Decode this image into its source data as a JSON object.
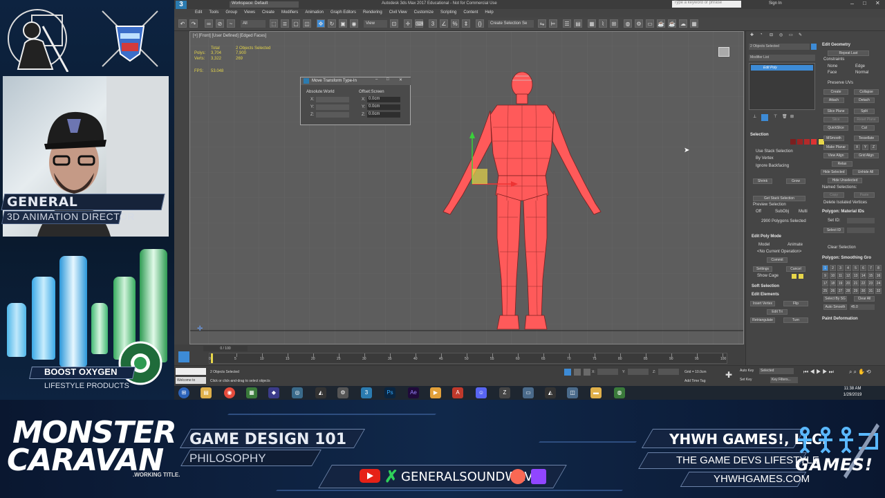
{
  "overlay": {
    "streamer_name": "GENERAL SOUNDWAVE",
    "streamer_title": "3D ANIMATION DIRECTOR",
    "sponsor_name": "BOOST OXYGEN",
    "sponsor_sub": "LIFESTYLE PRODUCTS",
    "show_title_1": "MONSTER",
    "show_title_2": "CARAVAN",
    "show_tagline": ".WORKING TITLE.",
    "topic": "GAME DESIGN 101",
    "subtopic": "PHILOSOPHY",
    "social_handle": "GENERALSOUNDWAVE",
    "company": "YHWH GAMES!, LLC.",
    "company_tagline": "THE GAME DEVS LIFESTYLE",
    "company_url": "YHWHGAMES.COM",
    "company_logo_text": "GAMES!"
  },
  "app": {
    "title": "Autodesk 3ds Max 2017 Educational - Not for Commercial Use",
    "workspace": "Workspace: Default",
    "search_placeholder": "Type a keyword or phrase",
    "sign_in": "Sign In",
    "menu": [
      "Edit",
      "Tools",
      "Group",
      "Views",
      "Create",
      "Modifiers",
      "Animation",
      "Graph Editors",
      "Rendering",
      "Civil View",
      "Customize",
      "Scripting",
      "Content",
      "Help"
    ],
    "toolbar_dropdown_all": "All",
    "toolbar_view": "View",
    "toolbar_selection_set": "Create Selection Se",
    "viewport_label": "[+] [Front] [User Defined] [Edged Faces]",
    "stats": {
      "total_label": "Total",
      "selected_label": "2 Objects Selected",
      "polys_label": "Polys:",
      "polys_total": "3,704",
      "polys_sel": "7,900",
      "verts_label": "Verts:",
      "verts_total": "3,322",
      "verts_sel": "269",
      "fps_label": "FPS:",
      "fps_value": "53.048"
    },
    "dialog": {
      "title": "Move Transform Type-In",
      "absolute": "Absolute:World",
      "offset": "Offset:Screen",
      "x": "X:",
      "y": "Y:",
      "z": "Z:",
      "ox": "0.0cm",
      "oy": "0.0cm",
      "oz": "0.0cm"
    },
    "timeline": {
      "frame": "0 / 100",
      "ticks": [
        "0",
        "5",
        "10",
        "15",
        "20",
        "25",
        "30",
        "35",
        "40",
        "45",
        "50",
        "55",
        "60",
        "65",
        "70",
        "75",
        "80",
        "85",
        "90",
        "95",
        "100"
      ]
    },
    "status": {
      "selected": "2 Objects Selected",
      "prompt": "Click or click-and-drag to select objects",
      "welcome": "Welcome to",
      "x": "X:",
      "y": "Y:",
      "z": "Z:",
      "grid": "Grid = 10.0cm",
      "add_time_tag": "Add Time Tag",
      "auto_key": "Auto Key",
      "set_key": "Set Key",
      "selected_dd": "Selected",
      "key_filters": "Key Filters..."
    },
    "command_panel": {
      "object_name": "2 Objects Selected",
      "modifier_list": "Modifier List",
      "edit_poly": "Edit Poly",
      "selection": "Selection",
      "use_stack": "Use Stack Selection",
      "by_vertex": "By Vertex",
      "ignore_backfacing": "Ignore Backfacing",
      "shrink": "Shrink",
      "grow": "Grow",
      "get_stack": "Get Stack Selection",
      "preview_selection": "Preview Selection",
      "off": "Off",
      "subobj": "SubObj",
      "multi": "Multi",
      "poly_selected": "2900 Polygons Selected",
      "edit_poly_mode": "Edit Poly Mode",
      "model": "Model",
      "animate": "Animate",
      "no_current_op": "<No Current Operation>",
      "commit": "Commit",
      "settings": "Settings",
      "cancel": "Cancel",
      "show_cage": "Show Cage",
      "soft_selection": "Soft Selection",
      "edit_elements": "Edit Elements",
      "insert_vertex": "Insert Vertex",
      "flip": "Flip",
      "edit_tri": "Edit Tri",
      "retriangulate": "Retriangulate",
      "turn": "Turn",
      "edit_geometry": "Edit Geometry",
      "repeat_last": "Repeat Last",
      "constraints": "Constraints",
      "none": "None",
      "edge": "Edge",
      "face": "Face",
      "normal": "Normal",
      "preserve_uvs": "Preserve UVs",
      "create": "Create",
      "collapse": "Collapse",
      "attach": "Attach",
      "detach": "Detach",
      "slice_plane": "Slice Plane",
      "split": "Split",
      "slice": "Slice",
      "reset_plane": "Reset Plane",
      "quickslice": "QuickSlice",
      "cut": "Cut",
      "msmooth": "MSmooth",
      "tessellate": "Tessellate",
      "make_planar": "Make Planar",
      "x": "X",
      "y": "Y",
      "z": "Z",
      "view_align": "View Align",
      "grid_align": "Grid Align",
      "relax": "Relax",
      "hide_selected": "Hide Selected",
      "unhide_all": "Unhide All",
      "hide_unselected": "Hide Unselected",
      "named_selections": "Named Selections:",
      "copy": "Copy",
      "paste": "Paste",
      "delete_isolated": "Delete Isolated Vertices",
      "poly_material_ids": "Polygon: Material IDs",
      "set_id": "Set ID:",
      "select_id": "Select ID",
      "clear_selection": "Clear Selection",
      "poly_smoothing": "Polygon: Smoothing Gro",
      "smoothing_ids": [
        "1",
        "2",
        "3",
        "4",
        "5",
        "6",
        "7",
        "8",
        "9",
        "10",
        "11",
        "12",
        "13",
        "14",
        "15",
        "16",
        "17",
        "18",
        "19",
        "20",
        "21",
        "22",
        "23",
        "24",
        "25",
        "26",
        "27",
        "28",
        "29",
        "30",
        "31",
        "32"
      ],
      "select_by_sg": "Select By SG",
      "clear_all": "Clear All",
      "auto_smooth": "Auto Smooth",
      "auto_smooth_val": "45.0",
      "paint_deformation": "Paint Deformation"
    },
    "taskbar": {
      "time": "11:38 AM",
      "date": "1/29/2019"
    }
  },
  "colors": {
    "mesh": "#ff5a5a",
    "accent_blue": "#3d8bd6",
    "stats_yellow": "#e4d44a"
  }
}
